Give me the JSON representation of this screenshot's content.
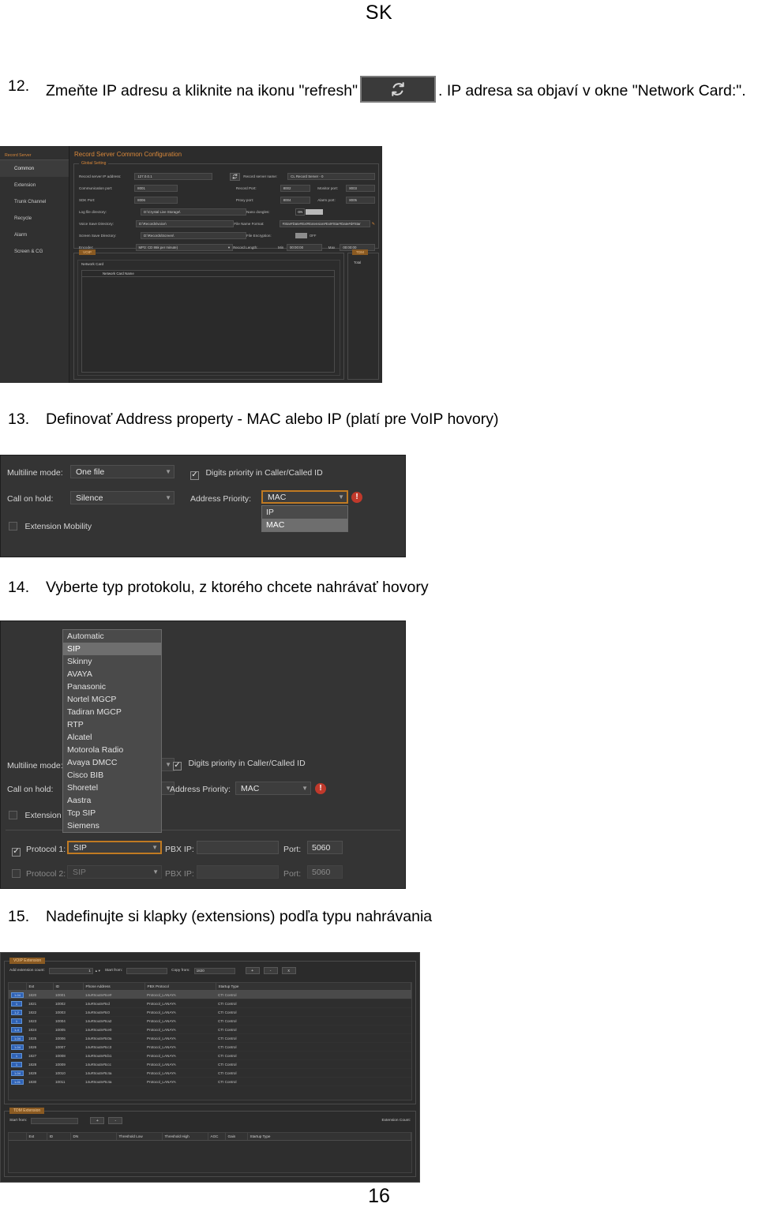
{
  "document": {
    "header": "SK",
    "page_number": "16"
  },
  "steps": [
    {
      "number": "12.",
      "text_before": "Zmeňte IP adresu a kliknite na ikonu \"refresh\"",
      "icon": "refresh-icon",
      "text_after": ". IP adresa sa objaví v okne \"Network Card:\"."
    },
    {
      "number": "13.",
      "text": "Definovať Address property - MAC alebo IP (platí pre VoIP hovory)"
    },
    {
      "number": "14.",
      "text": "Vyberte typ protokolu, z ktorého chcete nahrávať hovory"
    },
    {
      "number": "15.",
      "text": "Nadefinujte si klapky (extensions) podľa typu nahrávania"
    }
  ],
  "screenshot_record_server": {
    "window_title": "Record Server Common Configuration",
    "sidebar": {
      "title": "Record Server",
      "items": [
        {
          "label": "Common",
          "active": true
        },
        {
          "label": "Extension",
          "active": false
        },
        {
          "label": "Trunk Channel",
          "active": false
        },
        {
          "label": "Recycle",
          "active": false
        },
        {
          "label": "Alarm",
          "active": false
        },
        {
          "label": "Screen & CG",
          "active": false
        }
      ]
    },
    "global_setting": {
      "group_label": "Global Setting",
      "record_server_ip_label": "Record server IP address:",
      "record_server_ip_value": "127.0.0.1",
      "refresh_button_icon": "refresh-icon",
      "record_server_name_label": "Record server name:",
      "record_server_name_value": "CL Record Server - 0",
      "communication_port_label": "Communication port:",
      "communication_port_value": "8001",
      "record_port_label": "Record Port:",
      "record_port_value": "8002",
      "monitor_port_label": "Monitor port:",
      "monitor_port_value": "8003",
      "sdk_port_label": "SDK Port:",
      "sdk_port_value": "8006",
      "proxy_port_label": "Proxy port:",
      "proxy_port_value": "8004",
      "alarm_port_label": "Alarm port:",
      "alarm_port_value": "8005",
      "log_file_dir_label": "Log file directory:",
      "log_file_dir_value": "D:\\Crystal Live Storage\\",
      "nano_dongles_label": "Nano dongles:",
      "nano_dongles_state": "ON",
      "voice_save_dir_label": "Voice Save Directory:",
      "voice_save_dir_value": "D:\\Records\\voice\\",
      "file_name_format_label": "File Name Format:",
      "file_name_format_value": "#Star#Date#Ext#Extension#Ext#Star#Date#d#Star",
      "file_name_format_edit_icon": "pencil-icon",
      "screen_save_dir_label": "Screen Save Directory:",
      "screen_save_dir_value": "D:\\Records\\Screen\\",
      "file_encryption_label": "File Encryption:",
      "file_encryption_state": "OFF",
      "encoder_label": "Encoder:",
      "encoder_value": "MP3: CD 86k per minute)",
      "record_length_label": "Record Length:",
      "record_length_min_label": "Min",
      "record_length_min_value": "00:00:00",
      "record_length_max_label": "Max",
      "record_length_max_value": "00:00:00"
    },
    "voip_tab": "VOIP",
    "network_card_group": "Network Card",
    "network_card_column": "Network Card Name",
    "tdm_tab": "TDM",
    "tdm_total_label": "Total"
  },
  "screenshot_address_priority": {
    "multiline_mode_label": "Multiline mode:",
    "multiline_mode_value": "One file",
    "call_on_hold_label": "Call on hold:",
    "call_on_hold_value": "Silence",
    "extension_mobility_label": "Extension Mobility",
    "extension_mobility_checked": false,
    "digits_priority_label": "Digits priority in Caller/Called ID",
    "digits_priority_checked": true,
    "address_priority_label": "Address Priority:",
    "address_priority_value": "MAC",
    "address_priority_options": [
      "IP",
      "MAC"
    ],
    "address_priority_selected": "MAC",
    "warning_icon": "warning-icon"
  },
  "screenshot_protocol": {
    "protocol_options": [
      "Automatic",
      "SIP",
      "Skinny",
      "AVAYA",
      "Panasonic",
      "Nortel MGCP",
      "Tadiran MGCP",
      "RTP",
      "Alcatel",
      "Motorola Radio",
      "Avaya DMCC",
      "Cisco BIB",
      "Shoretel",
      "Aastra",
      "Tcp SIP",
      "Siemens"
    ],
    "protocol_selected": "SIP",
    "multiline_mode_label": "Multiline mode:",
    "call_on_hold_label": "Call on hold:",
    "extension_mobility_label": "Extension Mo",
    "digits_priority_label": "Digits priority in Caller/Called ID",
    "digits_priority_checked": true,
    "address_priority_label": "Address Priority:",
    "address_priority_value": "MAC",
    "warning_icon": "warning-icon",
    "protocol1_label": "Protocol 1:",
    "protocol1_checked": true,
    "protocol1_value": "SIP",
    "protocol1_pbx_ip_label": "PBX IP:",
    "protocol1_pbx_ip_value": "",
    "protocol1_port_label": "Port:",
    "protocol1_port_value": "5060",
    "protocol2_label": "Protocol 2:",
    "protocol2_checked": false,
    "protocol2_value": "SIP",
    "protocol2_pbx_ip_label": "PBX IP:",
    "protocol2_pbx_ip_value": "",
    "protocol2_port_label": "Port:",
    "protocol2_port_value": "5060"
  },
  "screenshot_extensions": {
    "voip_section": {
      "title": "VOIP Extension",
      "add_count_label": "Add extension count:",
      "add_count_value": "1",
      "start_from_label": "Start from:",
      "start_from_value": "",
      "copy_from_label": "Copy from:",
      "copy_from_value": "1820",
      "add_button": "+",
      "remove_button": "-",
      "delete_button": "x",
      "columns": [
        "Ext",
        "ID",
        "Phone Address",
        "PBX Protocol",
        "Startup Type"
      ],
      "rows": [
        {
          "chip": "1-04",
          "ext": "1820",
          "id": "10001",
          "phone": "14u#Soutn#tce#",
          "protocol": "Protocol_LANAYA",
          "startup": "CTI Control",
          "selected": true
        },
        {
          "chip": "1",
          "ext": "1821",
          "id": "10002",
          "phone": "14u#Soutn#tcd",
          "protocol": "Protocol_LANAYA",
          "startup": "CTI Control",
          "selected": false
        },
        {
          "chip": "1-2",
          "ext": "1822",
          "id": "10003",
          "phone": "14u#Soutn#tc0",
          "protocol": "Protocol_LANAYA",
          "startup": "CTI Control",
          "selected": false
        },
        {
          "chip": "1",
          "ext": "1823",
          "id": "10004",
          "phone": "14u#Soutn#tca2",
          "protocol": "Protocol_LANAYA",
          "startup": "CTI Control",
          "selected": false
        },
        {
          "chip": "1-4",
          "ext": "1824",
          "id": "10005",
          "phone": "14u#Soutn#tce0",
          "protocol": "Protocol_LANAYA",
          "startup": "CTI Control",
          "selected": false
        },
        {
          "chip": "1-04",
          "ext": "1825",
          "id": "10006",
          "phone": "14u#Soutn#tc0a",
          "protocol": "Protocol_LANAYA",
          "startup": "CTI Control",
          "selected": false
        },
        {
          "chip": "1-04",
          "ext": "1826",
          "id": "10007",
          "phone": "14u#Soutn#tcc3",
          "protocol": "Protocol_LANAYA",
          "startup": "CTI Control",
          "selected": false
        },
        {
          "chip": "1",
          "ext": "1827",
          "id": "10008",
          "phone": "14u#Soutn#tcb1",
          "protocol": "Protocol_LANAYA",
          "startup": "CTI Control",
          "selected": false
        },
        {
          "chip": "1",
          "ext": "1828",
          "id": "10009",
          "phone": "14u#Soutn#tccc",
          "protocol": "Protocol_LANAYA",
          "startup": "CTI Control",
          "selected": false
        },
        {
          "chip": "1-04",
          "ext": "1829",
          "id": "10010",
          "phone": "14u#Soutn#tc4a",
          "protocol": "Protocol_LANAYA",
          "startup": "CTI Control",
          "selected": false
        },
        {
          "chip": "1-01",
          "ext": "1830",
          "id": "10011",
          "phone": "14u#Soutn#tc4a",
          "protocol": "Protocol_LANAYA",
          "startup": "CTI Control",
          "selected": false
        }
      ]
    },
    "tdm_section": {
      "title": "TDM Extension",
      "start_from_label": "Start from:",
      "start_from_value": "",
      "add_button": "+",
      "remove_button": "-",
      "extension_count_label": "Extension Count:",
      "columns": [
        "Ext",
        "ID",
        "DN",
        "Threshold Low",
        "Threshold High",
        "AGC",
        "Gain",
        "Startup Type"
      ]
    }
  }
}
